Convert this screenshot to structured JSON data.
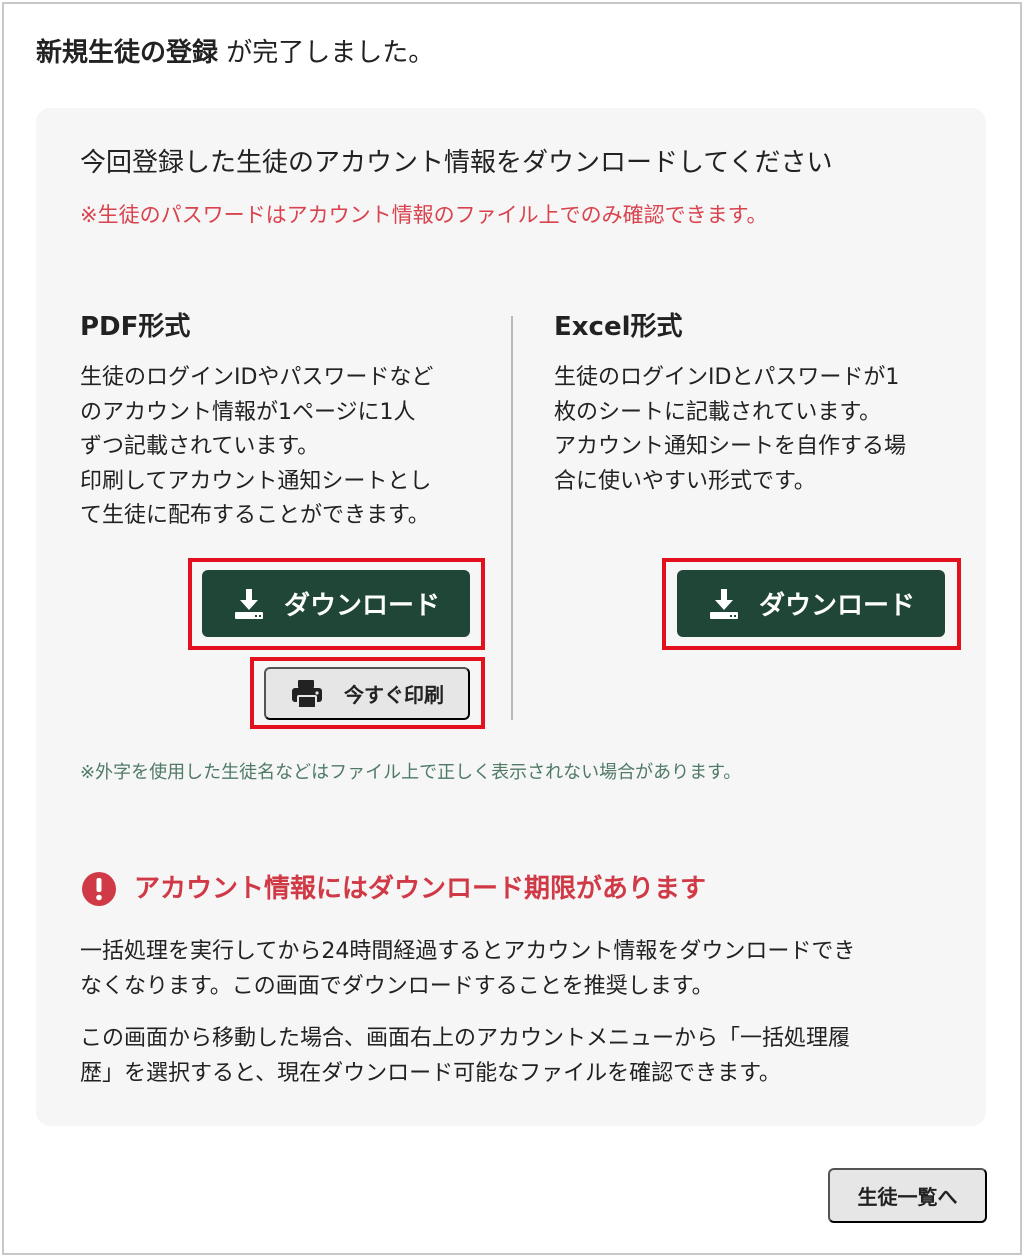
{
  "header": {
    "bold_text": "新規生徒の登録",
    "rest_text": " が完了しました。"
  },
  "panel": {
    "lead": "今回登録した生徒のアカウント情報をダウンロードしてください",
    "warning": "※生徒のパスワードはアカウント情報のファイル上でのみ確認できます。"
  },
  "pdf": {
    "title": "PDF形式",
    "description_lines": [
      "生徒のログインIDやパスワードなど",
      "のアカウント情報が1ページに1人",
      "ずつ記載されています。",
      "印刷してアカウント通知シートとし",
      "て生徒に配布することができます。"
    ],
    "download_label": "ダウンロード",
    "print_label": "今すぐ印刷"
  },
  "excel": {
    "title": "Excel形式",
    "description_lines": [
      "生徒のログインIDとパスワードが1",
      "枚のシートに記載されています。",
      "アカウント通知シートを自作する場",
      "合に使いやすい形式です。"
    ],
    "download_label": "ダウンロード"
  },
  "note": "※外字を使用した生徒名などはファイル上で正しく表示されない場合があります。",
  "alert": {
    "title": "アカウント情報にはダウンロード期限があります",
    "paragraph1_lines": [
      "一括処理を実行してから24時間経過するとアカウント情報をダウンロードでき",
      "なくなります。この画面でダウンロードすることを推奨します。"
    ],
    "paragraph2_lines": [
      "この画面から移動した場合、画面右上のアカウントメニューから「一括処理履",
      "歴」を選択すると、現在ダウンロード可能なファイルを確認できます。"
    ]
  },
  "footer": {
    "student_list_label": "生徒一覧へ"
  },
  "colors": {
    "primary_button": "#1f4636",
    "warning_text": "#d9434e",
    "alert_text": "#d03a47",
    "note_text": "#4f7a66",
    "highlight_border": "#e3101d",
    "panel_bg": "#f6f6f6"
  },
  "icons": {
    "download": "download-icon",
    "print": "printer-icon",
    "alert": "exclamation-circle-icon"
  }
}
